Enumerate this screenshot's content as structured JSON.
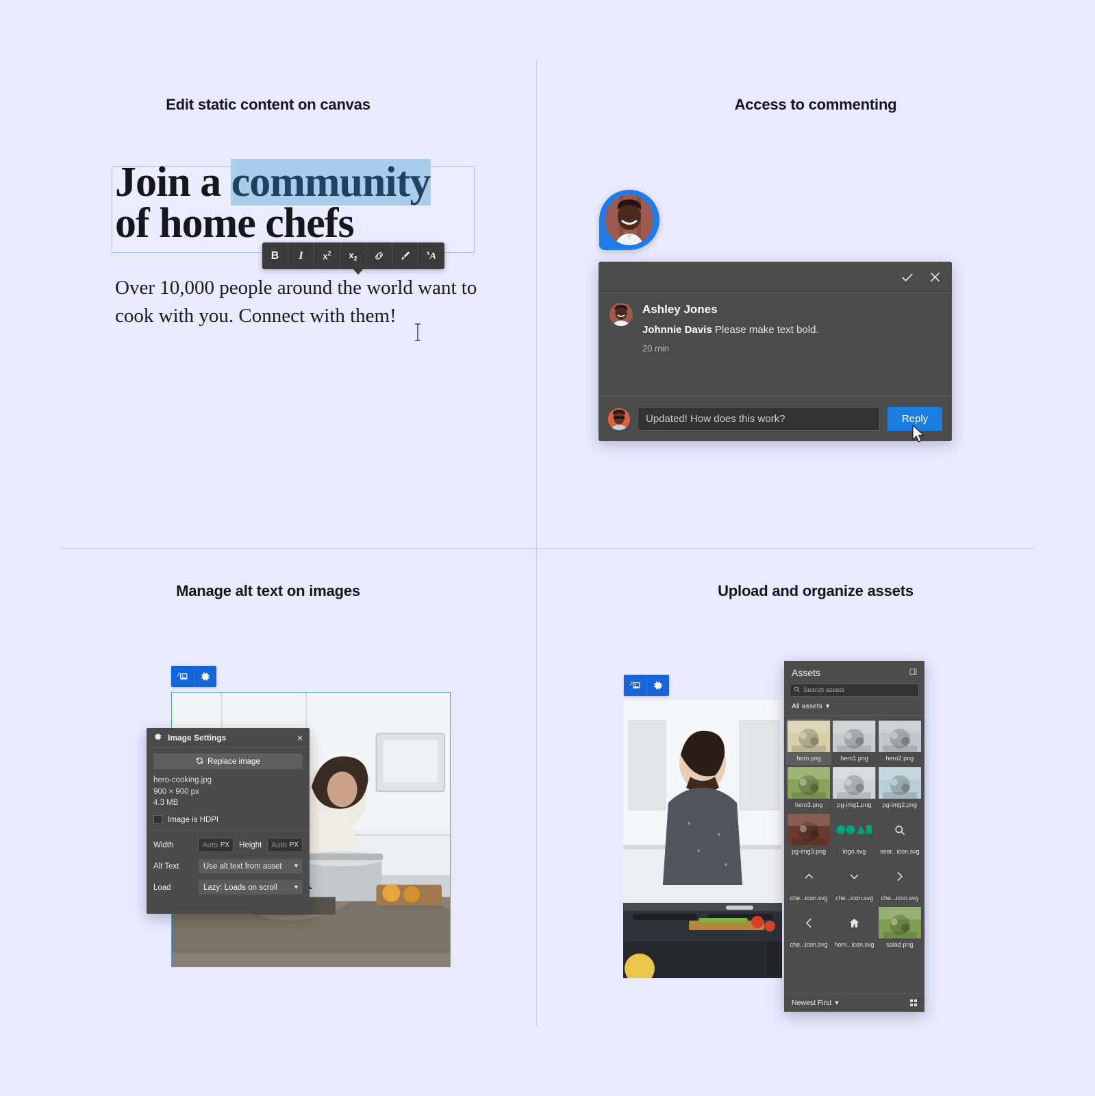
{
  "page": {
    "background": "#e9eaff",
    "accent_blue": "#1a7ee0",
    "panel_dark": "#4b4b4b"
  },
  "quadrants": [
    {
      "id": "edit-static-content",
      "title": "Edit static content on canvas"
    },
    {
      "id": "access-commenting",
      "title": "Access to commenting"
    },
    {
      "id": "manage-alt-text",
      "title": "Manage alt text on images"
    },
    {
      "id": "upload-organize-assets",
      "title": "Upload and organize assets"
    }
  ],
  "canvas_editor": {
    "headline_part1": "Join a ",
    "headline_selected": "community",
    "headline_part2": "of home chefs",
    "subtext": "Over 10,000 people around the world want to cook with you. Connect with them!",
    "selection_color": "#aacdeb",
    "toolbar": {
      "items": [
        {
          "name": "bold-button",
          "label": "B"
        },
        {
          "name": "italic-button",
          "label": "I"
        },
        {
          "name": "superscript-button",
          "label": "x2"
        },
        {
          "name": "subscript-button",
          "label": "x2"
        },
        {
          "name": "link-button",
          "label": "link-icon"
        },
        {
          "name": "format-paint-button",
          "label": "brush-icon"
        },
        {
          "name": "clear-format-button",
          "label": "xA"
        }
      ]
    }
  },
  "comment_thread": {
    "actions": {
      "resolve": "resolve-check-icon",
      "close": "close-icon"
    },
    "author": "Ashley Jones",
    "mention": "Johnnie Davis",
    "message": " Please make text bold.",
    "timestamp": "20 min",
    "reply_input_value": "Updated! How does this work?",
    "reply_input_placeholder": "Reply",
    "reply_button": "Reply"
  },
  "image_settings": {
    "title": "Image Settings",
    "close": "×",
    "replace_button": "Replace image",
    "file_name": "hero-cooking.jpg",
    "dimensions": "900 × 900 px",
    "file_size": "4.3 MB",
    "hdpi_label": "Image is HDPI",
    "hdpi_checked": false,
    "width_label": "Width",
    "width_value": "Auto",
    "width_unit": "PX",
    "height_label": "Height",
    "height_value": "Auto",
    "height_unit": "PX",
    "alt_text_label": "Alt Text",
    "alt_text_value": "Use alt text from asset",
    "load_label": "Load",
    "load_value": "Lazy: Loads on scroll"
  },
  "image_badge": {
    "replace_icon": "swap-image-icon",
    "settings_icon": "gear-icon"
  },
  "assets_panel": {
    "title": "Assets",
    "collapse_icon": "collapse-panel-icon",
    "search_placeholder": "Search assets",
    "search_icon": "search-icon",
    "filter_label": "All assets",
    "sort_label": "Newest First",
    "view_toggle": "grid-view-icon",
    "items": [
      {
        "name": "hero.png",
        "kind": "photo",
        "selected": true,
        "tone": "#d7cfa8"
      },
      {
        "name": "hero1.png",
        "kind": "photo",
        "selected": false,
        "tone": "#c9ccd0"
      },
      {
        "name": "hero2.png",
        "kind": "photo",
        "selected": false,
        "tone": "#c2c7cc"
      },
      {
        "name": "hero3.png",
        "kind": "photo",
        "selected": false,
        "tone": "#8aa25a"
      },
      {
        "name": "pg-img1.png",
        "kind": "photo",
        "selected": false,
        "tone": "#cfd4d8"
      },
      {
        "name": "pg-img2.png",
        "kind": "photo",
        "selected": false,
        "tone": "#b9cfd6"
      },
      {
        "name": "pg-img3.png",
        "kind": "photo",
        "selected": false,
        "tone": "#6d3b2c"
      },
      {
        "name": "logo.svg",
        "kind": "logo",
        "selected": false,
        "tone": "#00a07a"
      },
      {
        "name": "sear...icon.svg",
        "kind": "search",
        "selected": false,
        "tone": "#e6e6e6"
      },
      {
        "name": "che...icon.svg",
        "kind": "up",
        "selected": false,
        "tone": "#e6e6e6"
      },
      {
        "name": "che...icon.svg",
        "kind": "down",
        "selected": false,
        "tone": "#e6e6e6"
      },
      {
        "name": "che...icon.svg",
        "kind": "right",
        "selected": false,
        "tone": "#e6e6e6"
      },
      {
        "name": "che...icon.svg",
        "kind": "left",
        "selected": false,
        "tone": "#e6e6e6"
      },
      {
        "name": "hom...icon.svg",
        "kind": "home",
        "selected": false,
        "tone": "#e6e6e6"
      },
      {
        "name": "salad.png",
        "kind": "photo",
        "selected": false,
        "tone": "#7f9e54"
      }
    ]
  }
}
